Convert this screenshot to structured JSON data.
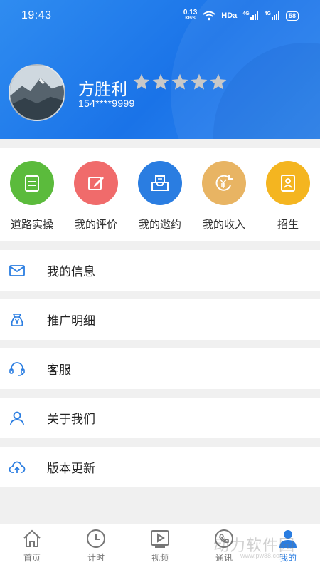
{
  "status_bar": {
    "time": "19:43",
    "net_speed": "0.13",
    "net_unit": "KB/S",
    "hd": "HDa",
    "signal1": "4G",
    "signal2": "4G",
    "battery": "58"
  },
  "profile": {
    "name": "方胜利",
    "phone": "154****9999",
    "rating": 5,
    "rating_max": 5
  },
  "quick_actions": [
    {
      "label": "道路实操",
      "color": "#5bbb3c",
      "icon": "clipboard-icon"
    },
    {
      "label": "我的评价",
      "color": "#f06b6b",
      "icon": "edit-icon"
    },
    {
      "label": "我的邀约",
      "color": "#2a7de1",
      "icon": "inbox-icon"
    },
    {
      "label": "我的收入",
      "color": "#e8b463",
      "icon": "yuan-icon"
    },
    {
      "label": "招生",
      "color": "#f4b520",
      "icon": "contact-card-icon"
    }
  ],
  "menu": [
    {
      "label": "我的信息",
      "icon": "mail-icon"
    },
    {
      "label": "推广明细",
      "icon": "yuan-bag-icon"
    },
    {
      "label": "客服",
      "icon": "headset-icon"
    },
    {
      "label": "关于我们",
      "icon": "user-icon"
    },
    {
      "label": "版本更新",
      "icon": "cloud-upload-icon"
    }
  ],
  "tabs": [
    {
      "label": "首页",
      "icon": "home-icon"
    },
    {
      "label": "计时",
      "icon": "clock-icon"
    },
    {
      "label": "视频",
      "icon": "video-icon"
    },
    {
      "label": "通讯",
      "icon": "phone-icon"
    },
    {
      "label": "我的",
      "icon": "profile-icon",
      "active": true
    }
  ],
  "watermark": {
    "text": "动力软件园",
    "url": "www.pw88.com"
  },
  "colors": {
    "header_blue": "#1a73e8",
    "accent_blue": "#2a7de1",
    "star_gray": "#c8c8c8"
  }
}
